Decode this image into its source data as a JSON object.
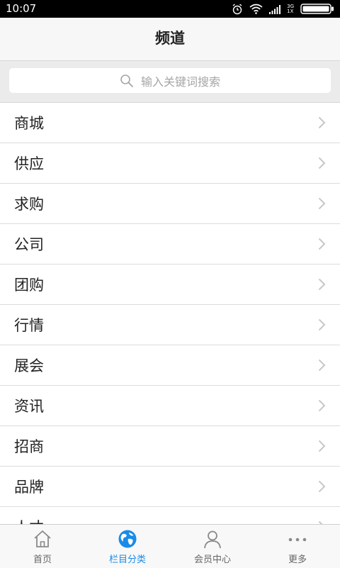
{
  "status_bar": {
    "time": "10:07",
    "icons": [
      "alarm-icon",
      "wifi-icon",
      "signal-icon",
      "battery-icon"
    ],
    "network_label": "3G",
    "sim_label": "1X"
  },
  "header": {
    "title": "频道"
  },
  "search": {
    "placeholder": "输入关键词搜索",
    "icon": "search-icon"
  },
  "channels": [
    {
      "label": "商城"
    },
    {
      "label": "供应"
    },
    {
      "label": "求购"
    },
    {
      "label": "公司"
    },
    {
      "label": "团购"
    },
    {
      "label": "行情"
    },
    {
      "label": "展会"
    },
    {
      "label": "资讯"
    },
    {
      "label": "招商"
    },
    {
      "label": "品牌"
    },
    {
      "label": "人才"
    }
  ],
  "tab_bar": {
    "tabs": [
      {
        "label": "首页",
        "icon": "home-icon",
        "active": false
      },
      {
        "label": "栏目分类",
        "icon": "globe-icon",
        "active": true
      },
      {
        "label": "会员中心",
        "icon": "user-icon",
        "active": false
      },
      {
        "label": "更多",
        "icon": "more-icon",
        "active": false
      }
    ]
  },
  "colors": {
    "accent": "#1a8be8",
    "status_bar": "#000000",
    "nav_bg": "#f7f7f7",
    "search_bg": "#ebebeb"
  }
}
